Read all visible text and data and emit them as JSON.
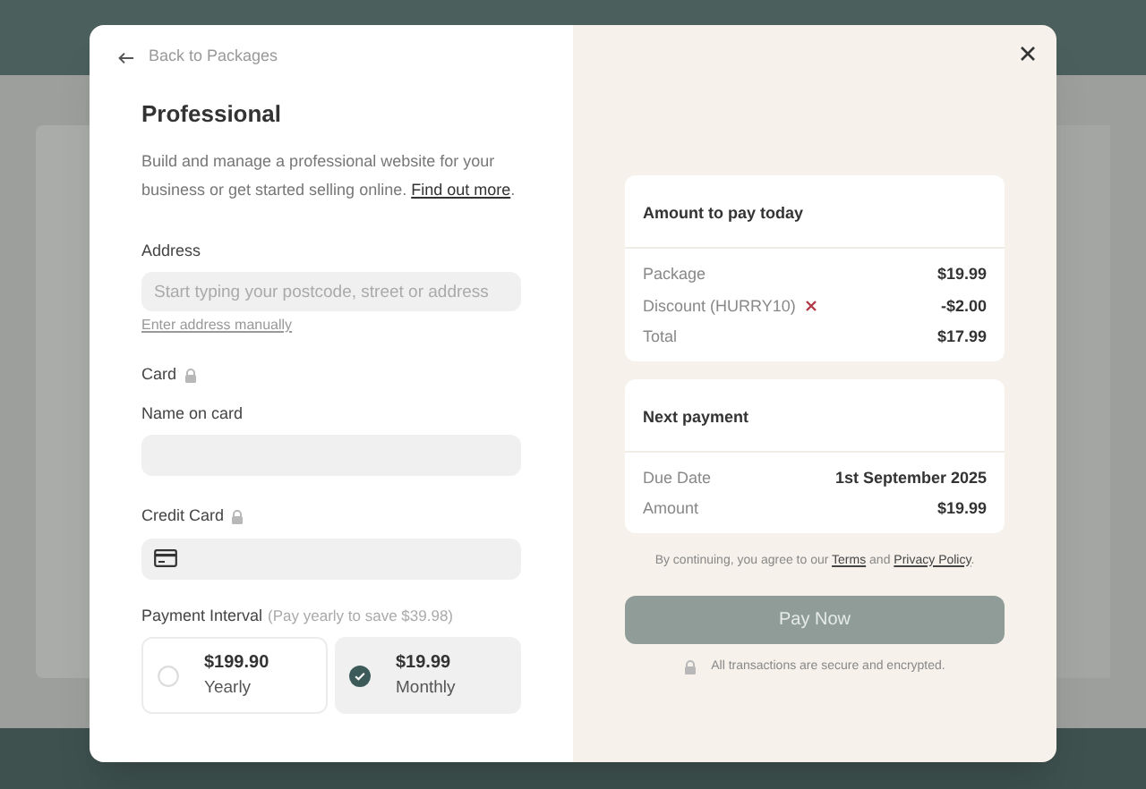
{
  "back_link": "Back to Packages",
  "title": "Professional",
  "description": "Build and manage a professional website for your business or get started selling online. ",
  "description_link": "Find out more",
  "description_end": ".",
  "address": {
    "label": "Address",
    "placeholder": "Start typing your postcode, street or address",
    "manual_link": "Enter address manually"
  },
  "card_section": "Card",
  "name_on_card": {
    "label": "Name on card"
  },
  "credit_card": {
    "label": "Credit Card"
  },
  "payment_interval": {
    "label": "Payment Interval",
    "hint": "(Pay yearly to save $39.98)",
    "options": [
      {
        "price": "$199.90",
        "period": "Yearly",
        "selected": false
      },
      {
        "price": "$19.99",
        "period": "Monthly",
        "selected": true
      }
    ]
  },
  "amount_today": {
    "title": "Amount to pay today",
    "rows": [
      {
        "label": "Package",
        "value": "$19.99",
        "removable": false
      },
      {
        "label": "Discount (HURRY10)",
        "value": "-$2.00",
        "removable": true
      },
      {
        "label": "Total",
        "value": "$17.99",
        "removable": false
      }
    ]
  },
  "next_payment": {
    "title": "Next payment",
    "rows": [
      {
        "label": "Due Date",
        "value": "1st September 2025",
        "removable": false
      },
      {
        "label": "Amount",
        "value": "$19.99",
        "removable": false
      }
    ]
  },
  "terms": {
    "before": "By continuing, you agree to our ",
    "terms_link": "Terms",
    "middle": " and ",
    "privacy_link": "Privacy Policy",
    "after": "."
  },
  "pay_button": {
    "label": "Pay Now",
    "disabled": true
  },
  "secure_note": "All transactions are secure and encrypted."
}
